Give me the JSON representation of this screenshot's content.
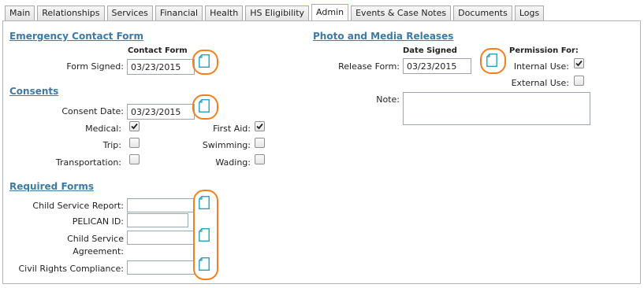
{
  "tabs": [
    {
      "label": "Main"
    },
    {
      "label": "Relationships"
    },
    {
      "label": "Services"
    },
    {
      "label": "Financial"
    },
    {
      "label": "Health"
    },
    {
      "label": "HS Eligibility"
    },
    {
      "label": "Admin"
    },
    {
      "label": "Events & Case Notes"
    },
    {
      "label": "Documents"
    },
    {
      "label": "Logs"
    }
  ],
  "active_tab": "Admin",
  "emergency": {
    "title": "Emergency Contact Form",
    "column_header": "Contact Form",
    "form_signed_label": "Form Signed:",
    "form_signed_value": "03/23/2015"
  },
  "consents": {
    "title": "Consents",
    "consent_date_label": "Consent Date:",
    "consent_date_value": "03/23/2015",
    "items": [
      {
        "label": "Medical:",
        "checked": true
      },
      {
        "label": "Trip:",
        "checked": false
      },
      {
        "label": "Transportation:",
        "checked": false
      },
      {
        "label": "First Aid:",
        "checked": true
      },
      {
        "label": "Swimming:",
        "checked": false
      },
      {
        "label": "Wading:",
        "checked": false
      }
    ]
  },
  "required_forms": {
    "title": "Required Forms",
    "child_service_report_label": "Child Service Report:",
    "child_service_report_value": "",
    "pelican_id_label": "PELICAN ID:",
    "pelican_id_value": "",
    "child_service_agreement_label_1": "Child Service",
    "child_service_agreement_label_2": "Agreement:",
    "child_service_agreement_value": "",
    "civil_rights_label": "Civil Rights Compliance:",
    "civil_rights_value": ""
  },
  "media": {
    "title": "Photo and Media Releases",
    "date_header": "Date Signed",
    "permission_header": "Permission For:",
    "release_form_label": "Release Form:",
    "release_form_value": "03/23/2015",
    "internal_use_label": "Internal Use:",
    "internal_use_checked": true,
    "external_use_label": "External Use:",
    "external_use_checked": false,
    "note_label": "Note:",
    "note_value": ""
  },
  "colors": {
    "link": "#3c7aa8",
    "highlight": "#f08020",
    "doc_icon": "#2a9fc4",
    "active_tab_border": "#e8a33a"
  },
  "icons": {
    "document": "document-icon",
    "check": "check-icon"
  }
}
